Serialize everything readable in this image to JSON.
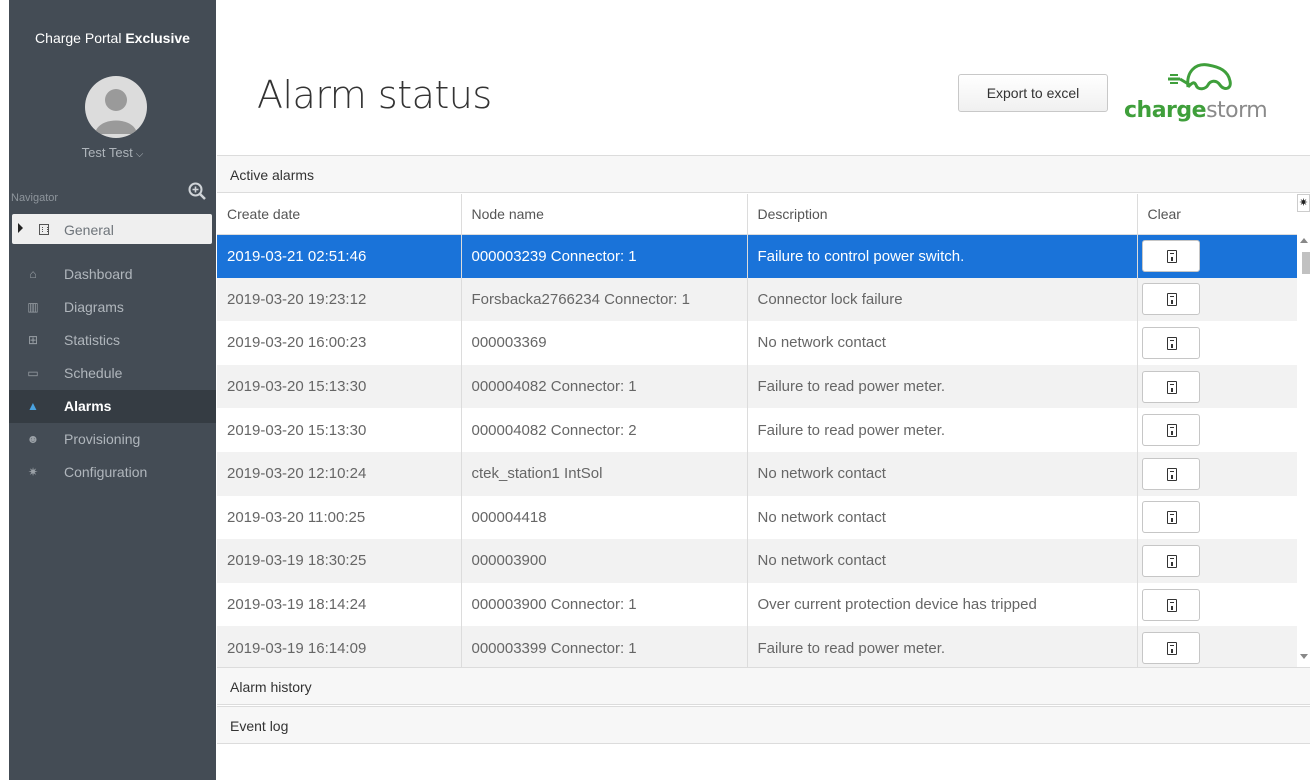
{
  "sidebar": {
    "brand_prefix": "Charge Portal ",
    "brand_bold": "Exclusive",
    "user_name": "Test Test",
    "user_chevron": "⌵",
    "navigator_label": "Navigator",
    "general_label": "General",
    "items": [
      {
        "label": "Dashboard",
        "icon": "home-icon",
        "glyph": "⌂"
      },
      {
        "label": "Diagrams",
        "icon": "bar-chart-icon",
        "glyph": "▥"
      },
      {
        "label": "Statistics",
        "icon": "table-icon",
        "glyph": "⊞"
      },
      {
        "label": "Schedule",
        "icon": "calendar-icon",
        "glyph": "▭"
      },
      {
        "label": "Alarms",
        "icon": "warning-icon",
        "glyph": "▲",
        "active": true
      },
      {
        "label": "Provisioning",
        "icon": "users-icon",
        "glyph": "☻"
      },
      {
        "label": "Configuration",
        "icon": "gear-icon",
        "glyph": "✷"
      }
    ]
  },
  "header": {
    "title": "Alarm status",
    "export_label": "Export to excel",
    "logo_bold": "charge",
    "logo_light": "storm"
  },
  "colors": {
    "brand_green": "#3f9f3b",
    "selected_row": "#1a73d9",
    "sidebar_bg": "#444c55"
  },
  "active_alarms": {
    "heading": "Active alarms",
    "columns": [
      "Create date",
      "Node name",
      "Description",
      "Clear"
    ],
    "rows": [
      {
        "date": "2019-03-21 02:51:46",
        "node": "000003239 Connector: 1",
        "desc": "Failure to control power switch."
      },
      {
        "date": "2019-03-20 19:23:12",
        "node": "Forsbacka2766234 Connector: 1",
        "desc": "Connector lock failure"
      },
      {
        "date": "2019-03-20 16:00:23",
        "node": "000003369",
        "desc": "No network contact"
      },
      {
        "date": "2019-03-20 15:13:30",
        "node": "000004082 Connector: 1",
        "desc": "Failure to read power meter."
      },
      {
        "date": "2019-03-20 15:13:30",
        "node": "000004082 Connector: 2",
        "desc": "Failure to read power meter."
      },
      {
        "date": "2019-03-20 12:10:24",
        "node": "ctek_station1 IntSol",
        "desc": "No network contact"
      },
      {
        "date": "2019-03-20 11:00:25",
        "node": "000004418",
        "desc": "No network contact"
      },
      {
        "date": "2019-03-19 18:30:25",
        "node": "000003900",
        "desc": "No network contact"
      },
      {
        "date": "2019-03-19 18:14:24",
        "node": "000003900 Connector: 1",
        "desc": "Over current protection device has tripped"
      },
      {
        "date": "2019-03-19 16:14:09",
        "node": "000003399 Connector: 1",
        "desc": "Failure to read power meter."
      }
    ]
  },
  "sections": {
    "alarm_history": "Alarm history",
    "event_log": "Event log"
  }
}
